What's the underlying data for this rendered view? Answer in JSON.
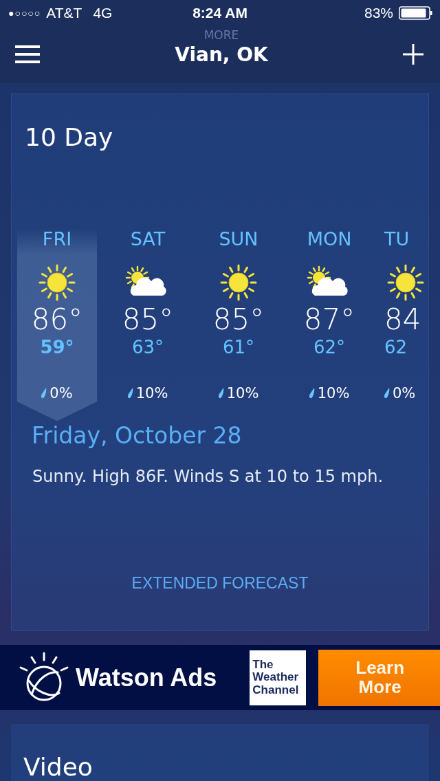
{
  "status_bar": {
    "signal": "●○○○○",
    "carrier": "AT&T",
    "network": "4G",
    "time": "8:24 AM",
    "battery": "83%"
  },
  "header": {
    "ghost_text": "MORE",
    "title": "Vian, OK"
  },
  "ten_day": {
    "title": "10 Day",
    "days": [
      {
        "label": "FRI",
        "kind": "sunny",
        "high": "86°",
        "low": "59°",
        "precip": "0%",
        "selected": true
      },
      {
        "label": "SAT",
        "kind": "partly_cloudy",
        "high": "85°",
        "low": "63°",
        "precip": "10%",
        "selected": false
      },
      {
        "label": "SUN",
        "kind": "sunny",
        "high": "85°",
        "low": "61°",
        "precip": "10%",
        "selected": false
      },
      {
        "label": "MON",
        "kind": "partly_cloudy",
        "high": "87°",
        "low": "62°",
        "precip": "10%",
        "selected": false
      },
      {
        "label": "TU",
        "kind": "sunny",
        "high": "84",
        "low": "62",
        "precip": "0%",
        "selected": false
      }
    ],
    "date": "Friday, October 28",
    "summary": "Sunny. High 86F. Winds S at 10 to 15 mph.",
    "link": "EXTENDED FORECAST"
  },
  "ad": {
    "brand": "Watson Ads",
    "logo_lines": [
      "The",
      "Weather",
      "Channel"
    ],
    "button": "Learn More"
  },
  "video": {
    "title": "Video"
  }
}
